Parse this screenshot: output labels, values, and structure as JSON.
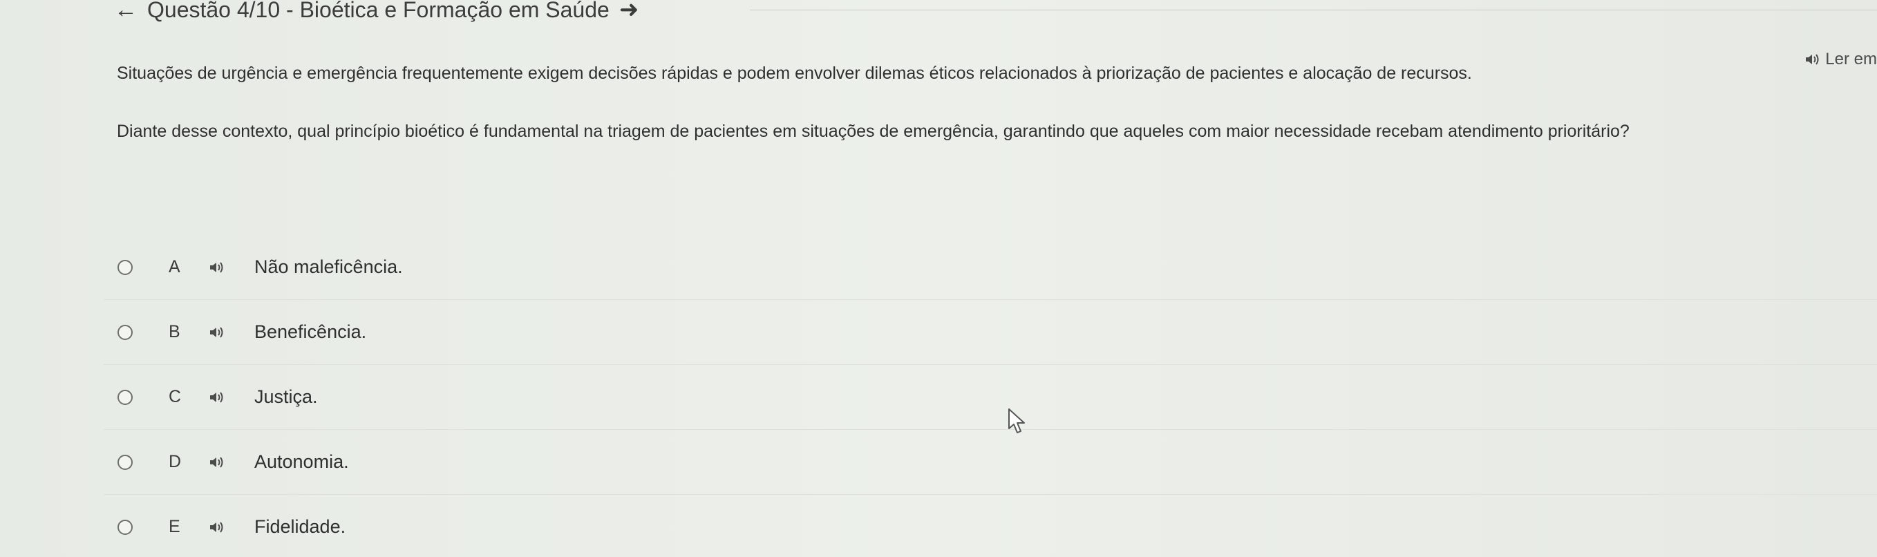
{
  "header": {
    "back_icon": "arrow-left-icon",
    "title": "Questão 4/10 - Bioética e Formação em Saúde",
    "forward_icon": "arrow-right-icon"
  },
  "read_aloud": {
    "icon": "speaker-icon",
    "label": "Ler em"
  },
  "statement": "Situações de urgência e emergência frequentemente exigem decisões rápidas e podem envolver dilemas éticos relacionados à priorização de pacientes e alocação de recursos.",
  "question": "Diante desse contexto, qual princípio bioético é fundamental na triagem de pacientes em situações de emergência, garantindo que aqueles com maior necessidade recebam atendimento prioritário?",
  "options": [
    {
      "letter": "A",
      "text": "Não maleficência."
    },
    {
      "letter": "B",
      "text": "Beneficência."
    },
    {
      "letter": "C",
      "text": "Justiça."
    },
    {
      "letter": "D",
      "text": "Autonomia."
    },
    {
      "letter": "E",
      "text": "Fidelidade."
    }
  ]
}
